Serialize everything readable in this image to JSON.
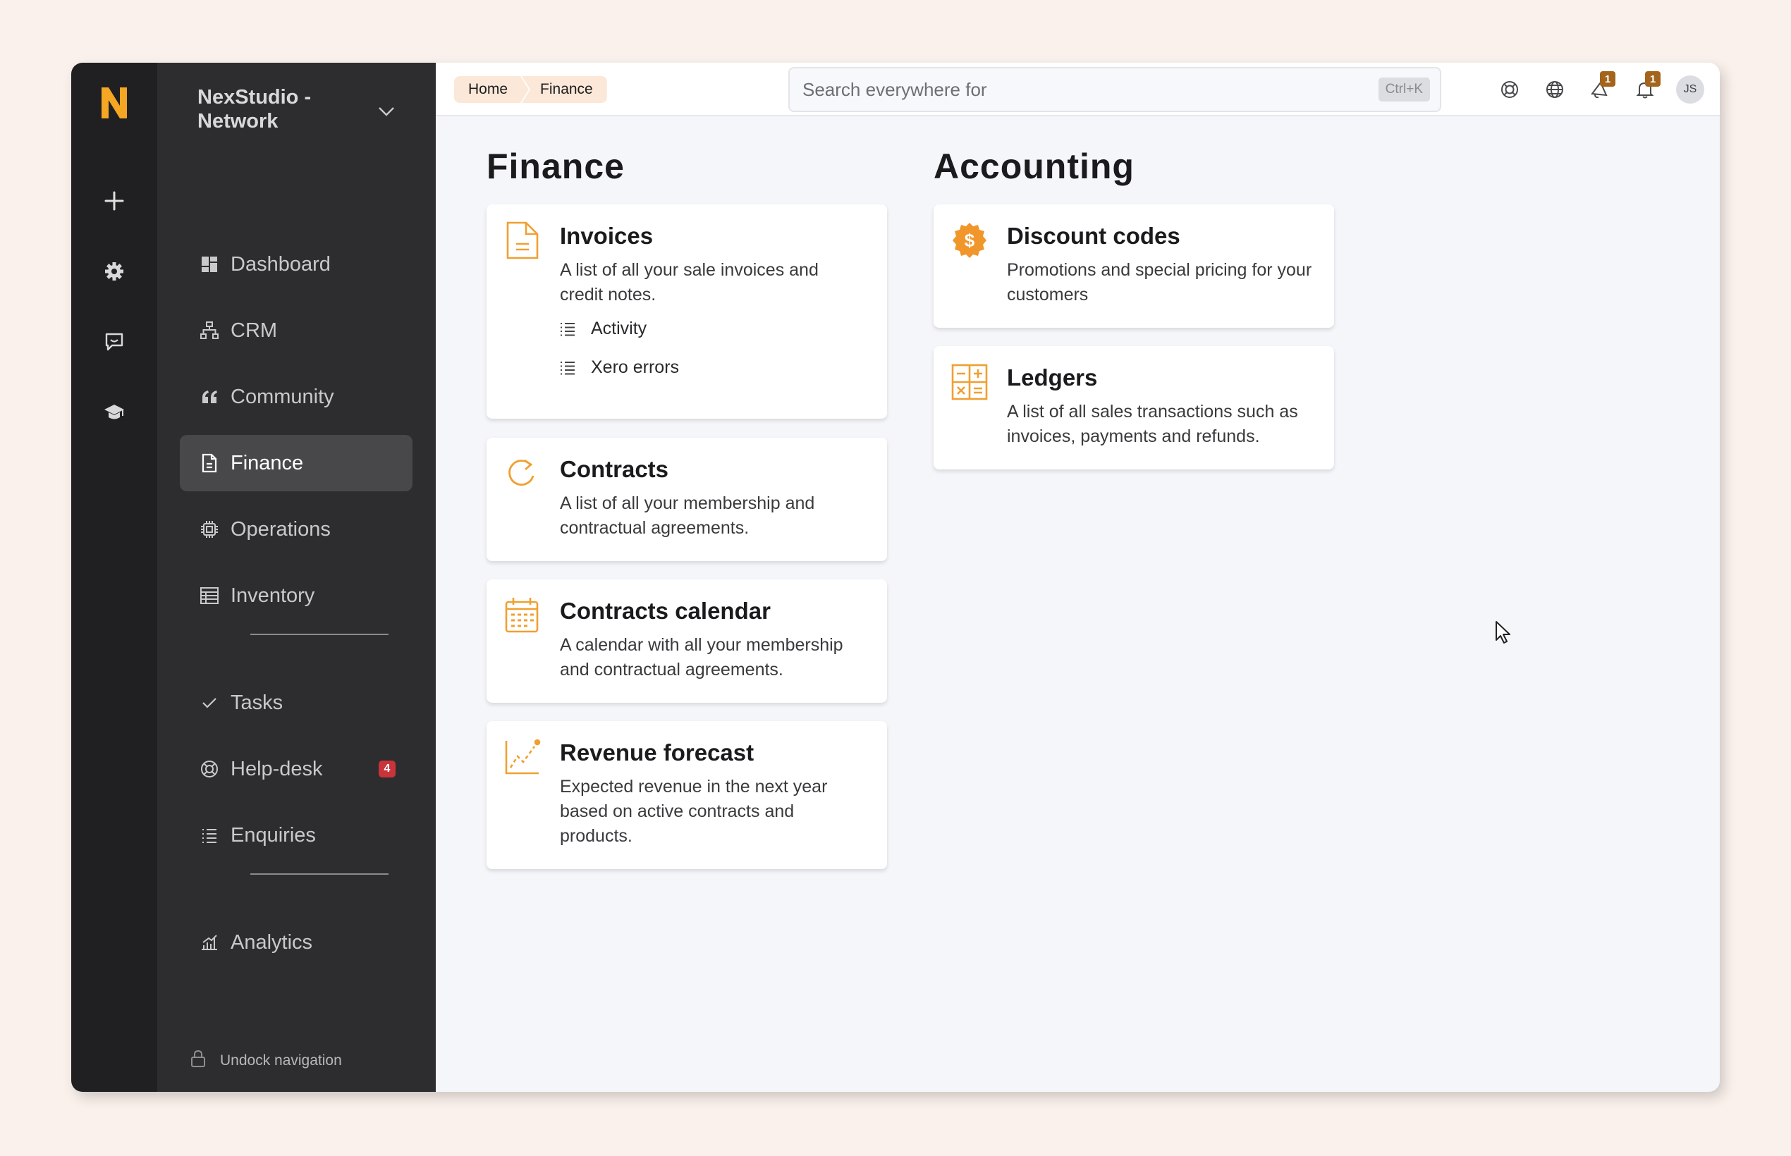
{
  "rail": {
    "logo_letter": "N",
    "brand_color": "#f5a623",
    "buttons": [
      "plus-icon",
      "gear-icon",
      "chat-icon",
      "graduation-cap-icon"
    ]
  },
  "org": {
    "name": "NexStudio - Network"
  },
  "nav": {
    "items": [
      {
        "label": "Dashboard",
        "icon": "dashboard-icon"
      },
      {
        "label": "CRM",
        "icon": "hierarchy-icon"
      },
      {
        "label": "Community",
        "icon": "quote-icon"
      },
      {
        "label": "Finance",
        "icon": "document-icon",
        "active": true
      },
      {
        "label": "Operations",
        "icon": "chip-icon"
      },
      {
        "label": "Inventory",
        "icon": "table-icon"
      }
    ],
    "items2": [
      {
        "label": "Tasks",
        "icon": "check-icon"
      },
      {
        "label": "Help-desk",
        "icon": "lifebuoy-icon",
        "badge": "4"
      },
      {
        "label": "Enquiries",
        "icon": "list-icon"
      }
    ],
    "items3": [
      {
        "label": "Analytics",
        "icon": "chart-icon"
      }
    ],
    "undock_label": "Undock navigation"
  },
  "topbar": {
    "breadcrumb": [
      "Home",
      "Finance"
    ],
    "search_placeholder": "Search everywhere for",
    "shortcut": "Ctrl+K",
    "announcements_count": "1",
    "notifications_count": "1",
    "avatar_initials": "JS"
  },
  "finance": {
    "title": "Finance",
    "cards": [
      {
        "title": "Invoices",
        "description": "A list of all your sale invoices and credit notes.",
        "icon": "invoice-icon",
        "links": [
          "Activity",
          "Xero errors"
        ]
      },
      {
        "title": "Contracts",
        "description": "A list of all your membership and contractual agreements.",
        "icon": "refresh-icon"
      },
      {
        "title": "Contracts calendar",
        "description": "A calendar with all your membership and contractual agreements.",
        "icon": "calendar-icon"
      },
      {
        "title": "Revenue forecast",
        "description": "Expected revenue in the next year based on active contracts and products.",
        "icon": "forecast-chart-icon"
      }
    ]
  },
  "accounting": {
    "title": "Accounting",
    "cards": [
      {
        "title": "Discount codes",
        "description": "Promotions and special pricing for your customers",
        "icon": "discount-badge-icon"
      },
      {
        "title": "Ledgers",
        "description": "A list of all sales transactions such as invoices, payments and refunds.",
        "icon": "calculator-icon"
      }
    ]
  },
  "colors": {
    "accent": "#f0a030",
    "badge_red": "#c8343a",
    "count_brown": "#a3641c"
  }
}
